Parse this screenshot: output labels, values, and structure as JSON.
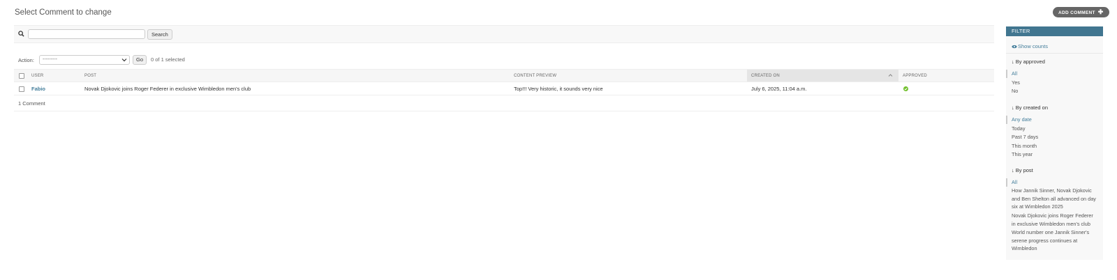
{
  "page": {
    "title": "Select Comment to change",
    "add_button_label": "ADD COMMENT",
    "add_button_icon": "plus-icon"
  },
  "search": {
    "value": "",
    "placeholder": "",
    "button_label": "Search",
    "icon": "search-icon"
  },
  "actions": {
    "label": "Action:",
    "selected_option": "---------",
    "go_label": "Go",
    "selected_count_text": "0 of 1 selected"
  },
  "table": {
    "columns": {
      "user": "USER",
      "post": "POST",
      "content_preview": "CONTENT PREVIEW",
      "created_on": "CREATED ON",
      "approved": "APPROVED"
    },
    "sorted_column": "created_on",
    "rows": [
      {
        "user": "Fabio",
        "post": "Novak Djokovic joins Roger Federer in exclusive Wimbledon men's club",
        "content_preview": "Top!!! Very historic, it sounds very nice",
        "created_on": "July 6, 2025, 11:04 a.m.",
        "approved": true
      }
    ]
  },
  "paginator": {
    "text": "1 Comment"
  },
  "filter": {
    "header": "FILTER",
    "show_counts_label": "Show counts",
    "groups": [
      {
        "title": "By approved",
        "items": [
          "All",
          "Yes",
          "No"
        ],
        "selected": "All"
      },
      {
        "title": "By created on",
        "items": [
          "Any date",
          "Today",
          "Past 7 days",
          "This month",
          "This year"
        ],
        "selected": "Any date"
      },
      {
        "title": "By post",
        "items": [
          "All",
          "How Jannik Sinner, Novak Djokovic and Ben Shelton all advanced on day six at Wimbledon 2025",
          "Novak Djokovic joins Roger Federer in exclusive Wimbledon men's club",
          "World number one Jannik Sinner's serene progress continues at Wimbledon"
        ],
        "selected": "All"
      }
    ]
  },
  "colors": {
    "accent": "#417690",
    "link": "#447e9b",
    "add_button_bg": "#666666",
    "approved_icon": "#70bf2b"
  }
}
